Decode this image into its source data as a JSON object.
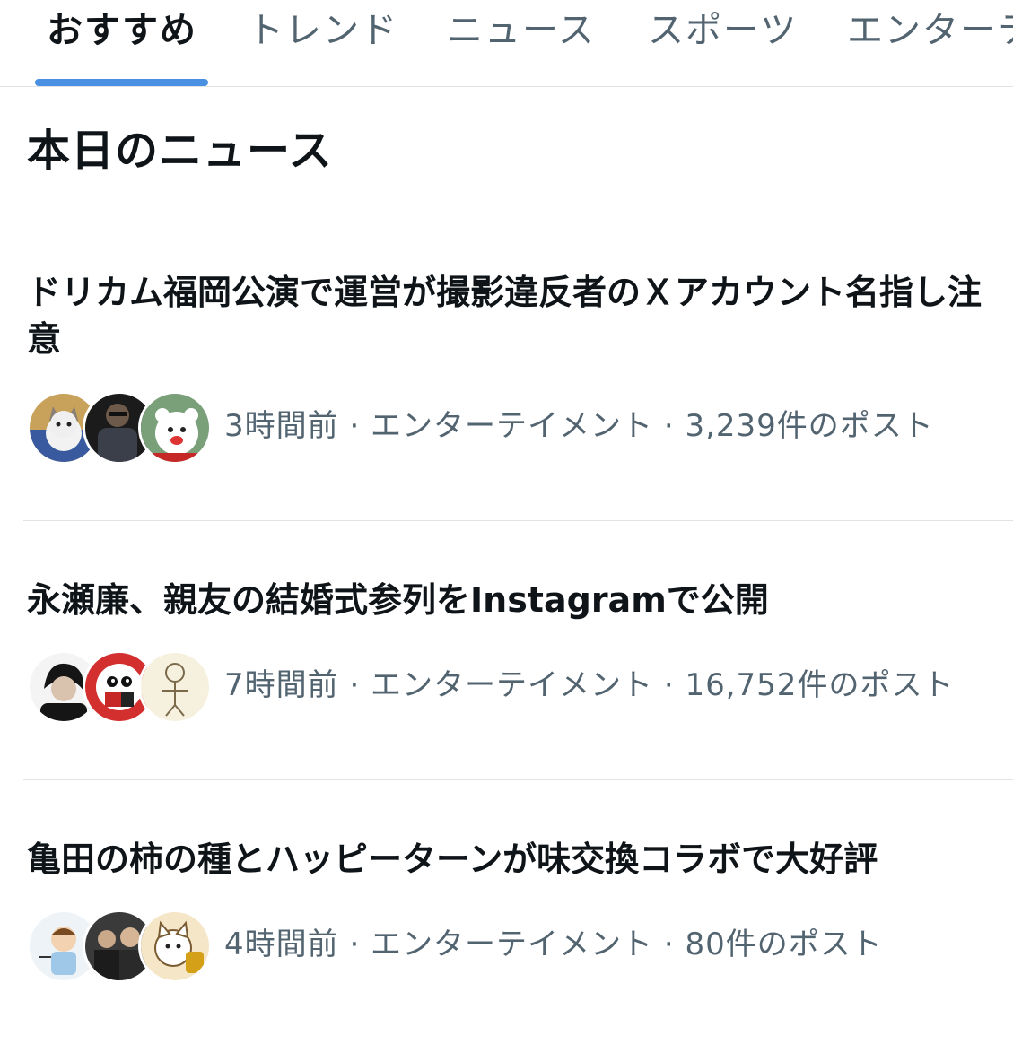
{
  "tabs": [
    {
      "label": "おすすめ",
      "active": true
    },
    {
      "label": "トレンド",
      "active": false
    },
    {
      "label": "ニュース",
      "active": false
    },
    {
      "label": "スポーツ",
      "active": false
    },
    {
      "label": "エンターテ",
      "active": false
    }
  ],
  "section_title": "本日のニュース",
  "news": [
    {
      "headline": "ドリカム福岡公演で運営が撮影違反者のＸアカウント名指し注意",
      "time": "3時間前",
      "category": "エンターテイメント",
      "posts": "3,239件のポスト",
      "meta": "3時間前 · エンターテイメント · 3,239件のポスト",
      "avatars": [
        "kitten-photo",
        "person-photo",
        "mascot-bear-photo"
      ]
    },
    {
      "headline": "永瀬廉、親友の結婚式参列をInstagramで公開",
      "time": "7時間前",
      "category": "エンターテイメント",
      "posts": "16,752件のポスト",
      "meta": "7時間前 · エンターテイメント · 16,752件のポスト",
      "avatars": [
        "person-photo",
        "cartoon-character-photo",
        "sketch-drawing-photo"
      ]
    },
    {
      "headline": "亀田の柿の種とハッピーターンが味交換コラボで大好評",
      "time": "4時間前",
      "category": "エンターテイメント",
      "posts": "80件のポスト",
      "meta": "4時間前 · エンターテイメント · 80件のポスト",
      "avatars": [
        "cartoon-boy-photo",
        "group-photo",
        "cartoon-cat-photo"
      ]
    }
  ],
  "colors": {
    "accent": "#4a90e2",
    "text_primary": "#0f1419",
    "text_secondary": "#536471",
    "divider": "#dfe3e6"
  }
}
